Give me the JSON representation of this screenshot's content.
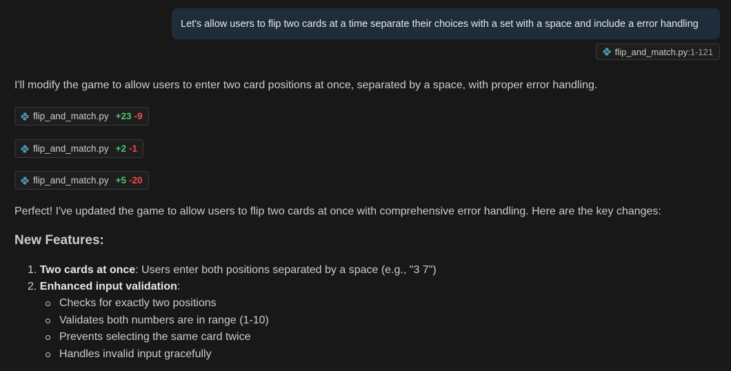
{
  "user_message": "Let's allow users to flip two cards at a time separate their choices with a set with a space and include a  error handling",
  "context_file": {
    "name": "flip_and_match.py",
    "range": ":1-121"
  },
  "reply_intro": "I'll modify the game to allow users to enter two card positions at once, separated by a space, with proper error handling.",
  "edits": [
    {
      "file": "flip_and_match.py",
      "added": "+23",
      "removed": "-9"
    },
    {
      "file": "flip_and_match.py",
      "added": "+2",
      "removed": "-1"
    },
    {
      "file": "flip_and_match.py",
      "added": "+5",
      "removed": "-20"
    }
  ],
  "summary": "Perfect! I've updated the game to allow users to flip two cards at once with comprehensive error handling. Here are the key changes:",
  "features_heading": "New Features:",
  "features": [
    {
      "number": "1.",
      "title": "Two cards at once",
      "text": ": Users enter both positions separated by a space (e.g., \"3 7\")"
    },
    {
      "number": "2.",
      "title": "Enhanced input validation",
      "text": ":"
    }
  ],
  "validation_points": [
    "Checks for exactly two positions",
    "Validates both numbers are in range (1-10)",
    "Prevents selecting the same card twice",
    "Handles invalid input gracefully"
  ],
  "colors": {
    "added": "#4ec46c",
    "removed": "#f14c4c",
    "bubble": "#1f2d3b"
  }
}
